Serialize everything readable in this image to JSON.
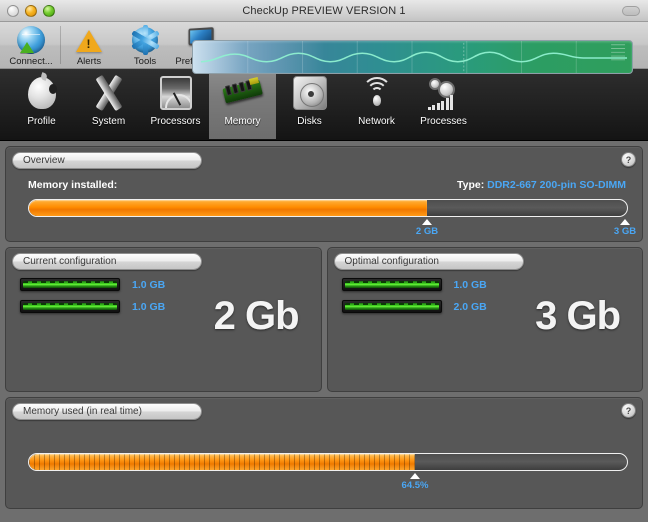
{
  "window": {
    "title": "CheckUp PREVIEW VERSION 1",
    "controls": {
      "close": "close",
      "minimize": "minimize",
      "zoom": "zoom"
    }
  },
  "toolbar": {
    "items": [
      {
        "label": "Connect...",
        "icon": "globe-connect-icon"
      },
      {
        "label": "Alerts",
        "icon": "warning-triangle-icon"
      },
      {
        "label": "Tools",
        "icon": "gear-icon"
      },
      {
        "label": "Preferences",
        "icon": "display-monitor-icon"
      }
    ],
    "graph": {
      "name": "activity-waveform-graph"
    }
  },
  "tabs": [
    {
      "label": "Profile",
      "icon": "apple-icon",
      "selected": false
    },
    {
      "label": "System",
      "icon": "x-icon",
      "selected": false
    },
    {
      "label": "Processors",
      "icon": "processor-icon",
      "selected": false
    },
    {
      "label": "Memory",
      "icon": "memory-module-icon",
      "selected": true
    },
    {
      "label": "Disks",
      "icon": "hard-disk-icon",
      "selected": false
    },
    {
      "label": "Network",
      "icon": "wireless-signal-icon",
      "selected": false
    },
    {
      "label": "Processes",
      "icon": "gears-chart-icon",
      "selected": false
    }
  ],
  "overview": {
    "title": "Overview",
    "help_label": "?",
    "installed_label": "Memory installed:",
    "type_prefix": "Type:",
    "type_value": "DDR2-667 200-pin SO-DIMM",
    "bar_fill_percent": 66.5,
    "markers": [
      {
        "label": "2 GB",
        "position_percent": 66.5
      },
      {
        "label": "3 GB",
        "position_percent": 99.5
      }
    ]
  },
  "current_config": {
    "title": "Current configuration",
    "slots": [
      {
        "size": "1.0 GB"
      },
      {
        "size": "1.0 GB"
      }
    ],
    "total": "2 Gb"
  },
  "optimal_config": {
    "title": "Optimal configuration",
    "slots": [
      {
        "size": "1.0 GB"
      },
      {
        "size": "2.0 GB"
      }
    ],
    "total": "3 Gb"
  },
  "memory_used": {
    "title": "Memory used (in real time)",
    "help_label": "?",
    "value_label": "64.5%",
    "value_percent": 64.5
  },
  "colors": {
    "accent_blue": "#4aa7f5",
    "bar_orange": "#ff8c00",
    "panel_gray": "#575757",
    "content_gray": "#6e6e6e",
    "tabbar_dark": "#202020"
  }
}
